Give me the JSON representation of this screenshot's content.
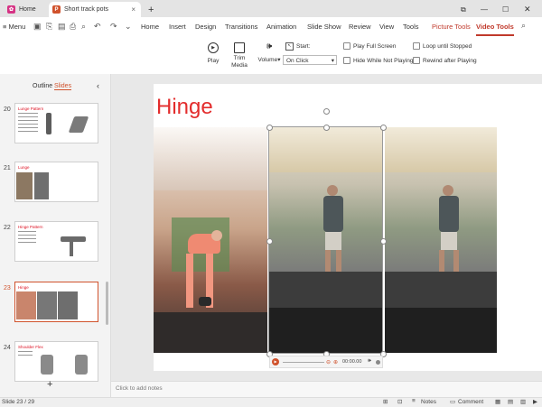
{
  "tabs": {
    "home": "Home",
    "document": "Short track pots",
    "new_tab": "+"
  },
  "menu": {
    "hamburger": "Menu",
    "items": [
      "Home",
      "Insert",
      "Design",
      "Transitions",
      "Animation",
      "Slide Show",
      "Review",
      "View",
      "Tools",
      "Picture Tools",
      "Video Tools"
    ]
  },
  "ribbon": {
    "play": "Play",
    "trim_line1": "Trim",
    "trim_line2": "Media",
    "volume": "Volume",
    "start_label": "Start:",
    "start_value": "On Click",
    "play_full_screen": "Play Full Screen",
    "hide_while_not_playing": "Hide While Not Playing",
    "loop_until_stopped": "Loop until Stopped",
    "rewind_after_playing": "Rewind after Playing"
  },
  "panel": {
    "outline_tab": "Outline",
    "slides_tab": "Slides",
    "collapse": "‹",
    "add_slide": "+",
    "slides": [
      {
        "num": "20",
        "title": "Lunge Pattern"
      },
      {
        "num": "21",
        "title": "Lunge"
      },
      {
        "num": "22",
        "title": "Hinge Pattern"
      },
      {
        "num": "23",
        "title": "Hinge"
      },
      {
        "num": "24",
        "title": "Shoulder Flex"
      }
    ]
  },
  "slide": {
    "title": "Hinge"
  },
  "video_controls": {
    "time": "00:00.00"
  },
  "notes_placeholder": "Click to add notes",
  "status": {
    "slide_counter": "Slide 23 / 29",
    "notes": "Notes",
    "comment": "Comment"
  },
  "colors": {
    "accent": "#d0522c",
    "video_tools": "#c0392b",
    "title_red": "#e32d2d"
  }
}
